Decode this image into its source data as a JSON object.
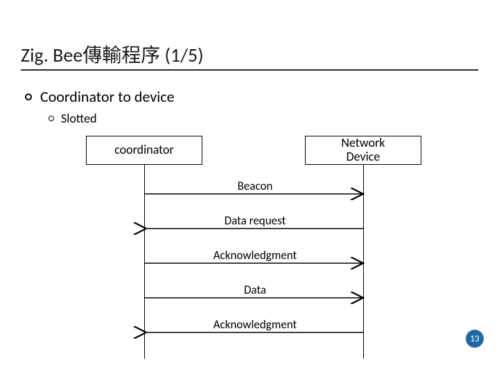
{
  "title": "Zig. Bee傳輸程序 (1/5)",
  "bullets": {
    "level1": "Coordinator  to device",
    "level2": "Slotted"
  },
  "nodes": {
    "coordinator": "coordinator",
    "device": "Network\nDevice"
  },
  "messages": [
    {
      "label": "Beacon",
      "dir": "right"
    },
    {
      "label": "Data request",
      "dir": "left"
    },
    {
      "label": "Acknowledgment",
      "dir": "right"
    },
    {
      "label": "Data",
      "dir": "right"
    },
    {
      "label": "Acknowledgment",
      "dir": "left"
    }
  ],
  "page_number": "13",
  "chart_data": {
    "type": "table",
    "description": "Sequence diagram: ZigBee coordinator-to-device slotted transfer",
    "participants": [
      "coordinator",
      "Network Device"
    ],
    "sequence": [
      {
        "from": "coordinator",
        "to": "Network Device",
        "label": "Beacon"
      },
      {
        "from": "Network Device",
        "to": "coordinator",
        "label": "Data request"
      },
      {
        "from": "coordinator",
        "to": "Network Device",
        "label": "Acknowledgment"
      },
      {
        "from": "coordinator",
        "to": "Network Device",
        "label": "Data"
      },
      {
        "from": "Network Device",
        "to": "coordinator",
        "label": "Acknowledgment"
      }
    ]
  }
}
